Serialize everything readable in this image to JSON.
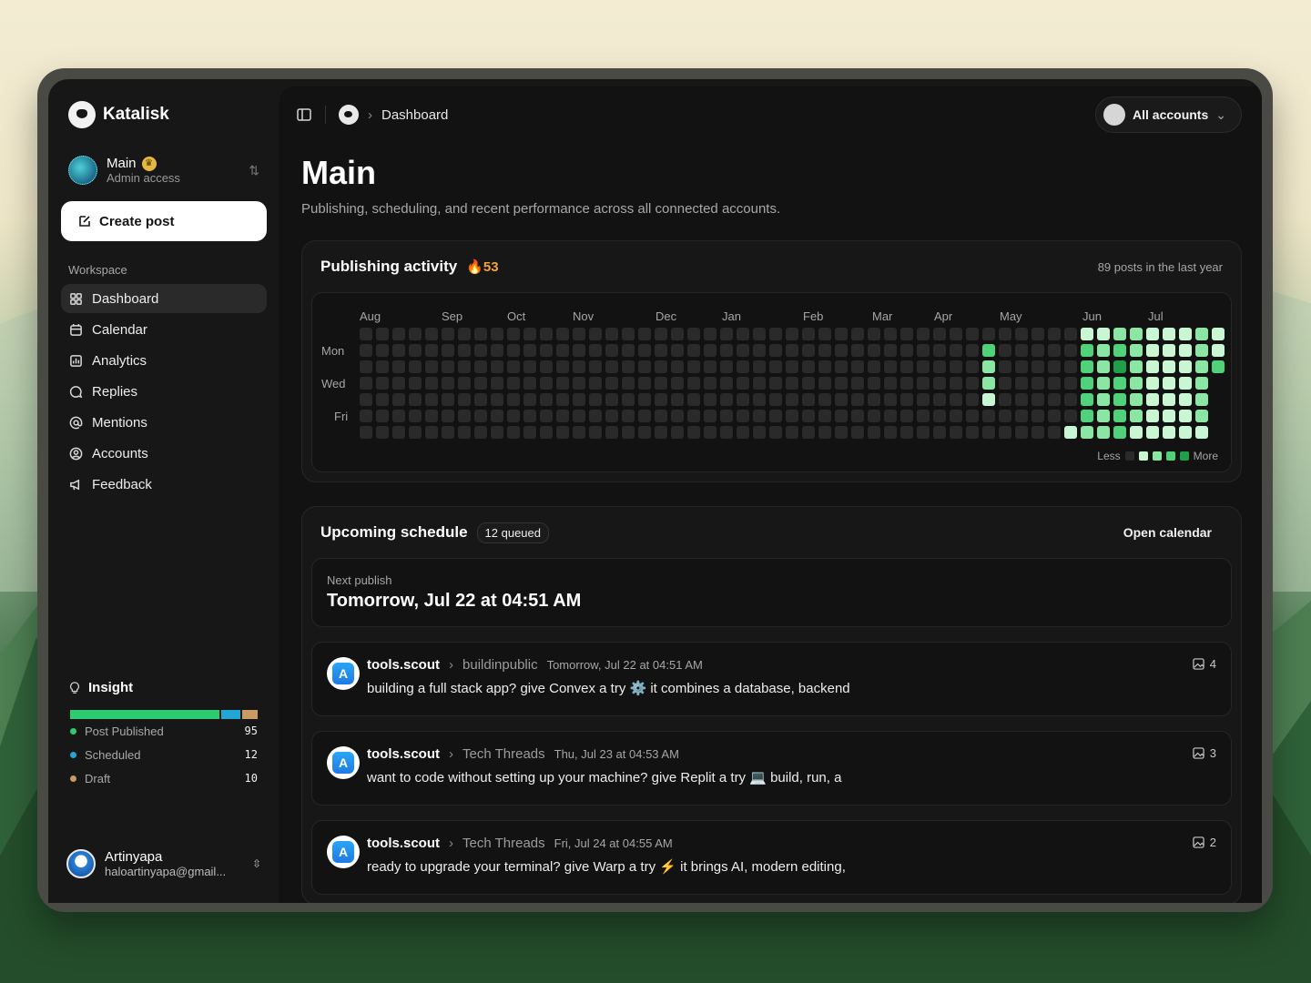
{
  "brand": {
    "name": "Katalisk"
  },
  "account": {
    "name": "Main",
    "role": "Admin access"
  },
  "sidebar": {
    "create_label": "Create post",
    "section_label": "Workspace",
    "items": [
      {
        "label": "Dashboard",
        "icon": "grid-icon",
        "active": true
      },
      {
        "label": "Calendar",
        "icon": "calendar-icon"
      },
      {
        "label": "Analytics",
        "icon": "chart-icon"
      },
      {
        "label": "Replies",
        "icon": "chat-icon"
      },
      {
        "label": "Mentions",
        "icon": "at-icon"
      },
      {
        "label": "Accounts",
        "icon": "user-circle-icon"
      },
      {
        "label": "Feedback",
        "icon": "megaphone-icon"
      }
    ]
  },
  "insight": {
    "title": "Insight",
    "stats": [
      {
        "label": "Post Published",
        "value": "95",
        "color": "#2ecc71"
      },
      {
        "label": "Scheduled",
        "value": "12",
        "color": "#22a6d6"
      },
      {
        "label": "Draft",
        "value": "10",
        "color": "#c99a63"
      }
    ]
  },
  "user": {
    "name": "Artinyapa",
    "email": "haloartinyapa@gmail..."
  },
  "topbar": {
    "breadcrumb": "Dashboard",
    "accounts_label": "All accounts"
  },
  "page": {
    "title": "Main",
    "subtitle": "Publishing, scheduling, and recent performance across all connected accounts."
  },
  "activity": {
    "title": "Publishing activity",
    "streak": "53",
    "meta": "89 posts in the last year",
    "months": [
      "Aug",
      "Sep",
      "Oct",
      "Nov",
      "Dec",
      "Jan",
      "Feb",
      "Mar",
      "Apr",
      "May",
      "Jun",
      "Jul"
    ],
    "day_labels": [
      "Mon",
      "Wed",
      "Fri"
    ],
    "legend_less": "Less",
    "legend_more": "More",
    "levels": [
      "#2a2a2a",
      "#c9f7d4",
      "#8be6a3",
      "#4fd27a",
      "#1f9f4a"
    ]
  },
  "schedule": {
    "title": "Upcoming schedule",
    "queued": "12 queued",
    "open_calendar": "Open calendar",
    "next_label": "Next publish",
    "next_time": "Tomorrow, Jul 22 at 04:51 AM",
    "posts": [
      {
        "handle": "tools.scout",
        "community": "buildinpublic",
        "time": "Tomorrow, Jul 22 at 04:51 AM",
        "text": "building a full stack app? give Convex a try ⚙️ it combines a database, backend",
        "media_count": "4"
      },
      {
        "handle": "tools.scout",
        "community": "Tech Threads",
        "time": "Thu, Jul 23 at 04:53 AM",
        "text": "want to code without setting up your machine? give Replit a try 💻 build, run, a",
        "media_count": "3"
      },
      {
        "handle": "tools.scout",
        "community": "Tech Threads",
        "time": "Fri, Jul 24 at 04:55 AM",
        "text": "ready to upgrade your terminal? give Warp a try ⚡ it brings AI, modern editing,",
        "media_count": "2"
      }
    ]
  }
}
